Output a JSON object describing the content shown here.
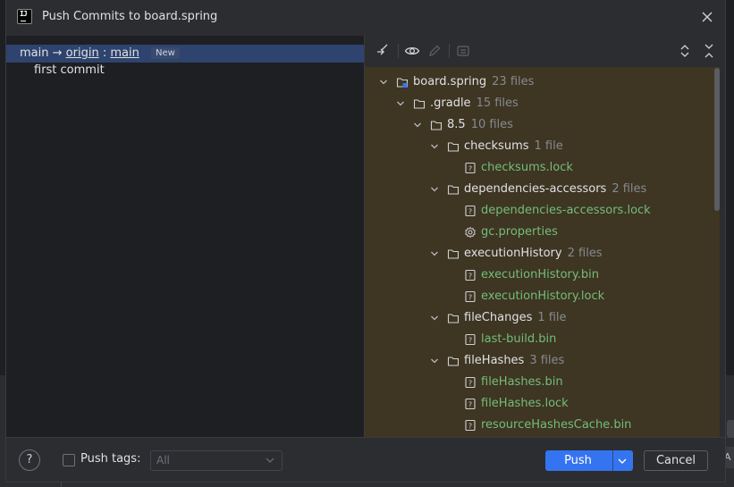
{
  "window": {
    "title": "Push Commits to board.spring",
    "app_icon_text": "IJ"
  },
  "commits": {
    "branch": {
      "local": "main",
      "arrow": "→",
      "remote": "origin",
      "colon": ":",
      "remote_branch": "main",
      "badge": "New"
    },
    "items": [
      {
        "message": "first commit"
      }
    ]
  },
  "toolbar": {
    "icons": [
      "collapse-icon",
      "eye-icon",
      "edit-icon",
      "group-icon",
      "expand-all-icon",
      "collapse-all-icon"
    ]
  },
  "tree": {
    "rows": [
      {
        "type": "module",
        "depth": 0,
        "name": "board.spring",
        "count": "23 files"
      },
      {
        "type": "folder",
        "depth": 1,
        "name": ".gradle",
        "count": "15 files"
      },
      {
        "type": "folder",
        "depth": 2,
        "name": "8.5",
        "count": "10 files"
      },
      {
        "type": "folder",
        "depth": 3,
        "name": "checksums",
        "count": "1 file"
      },
      {
        "type": "file",
        "depth": 4,
        "name": "checksums.lock",
        "icon": "unknown-file-icon"
      },
      {
        "type": "folder",
        "depth": 3,
        "name": "dependencies-accessors",
        "count": "2 files"
      },
      {
        "type": "file",
        "depth": 4,
        "name": "dependencies-accessors.lock",
        "icon": "unknown-file-icon"
      },
      {
        "type": "file",
        "depth": 4,
        "name": "gc.properties",
        "icon": "gear-icon"
      },
      {
        "type": "folder",
        "depth": 3,
        "name": "executionHistory",
        "count": "2 files"
      },
      {
        "type": "file",
        "depth": 4,
        "name": "executionHistory.bin",
        "icon": "unknown-file-icon"
      },
      {
        "type": "file",
        "depth": 4,
        "name": "executionHistory.lock",
        "icon": "unknown-file-icon"
      },
      {
        "type": "folder",
        "depth": 3,
        "name": "fileChanges",
        "count": "1 file"
      },
      {
        "type": "file",
        "depth": 4,
        "name": "last-build.bin",
        "icon": "unknown-file-icon"
      },
      {
        "type": "folder",
        "depth": 3,
        "name": "fileHashes",
        "count": "3 files"
      },
      {
        "type": "file",
        "depth": 4,
        "name": "fileHashes.bin",
        "icon": "unknown-file-icon"
      },
      {
        "type": "file",
        "depth": 4,
        "name": "fileHashes.lock",
        "icon": "unknown-file-icon"
      },
      {
        "type": "file",
        "depth": 4,
        "name": "resourceHashesCache.bin",
        "icon": "unknown-file-icon"
      }
    ]
  },
  "footer": {
    "help": "?",
    "push_tags_label": "Push tags:",
    "push_tags_checked": false,
    "tags_select_value": "All",
    "push_label": "Push",
    "cancel_label": "Cancel"
  },
  "background": {
    "edge_label": "A"
  },
  "colors": {
    "accent": "#3574f0",
    "selection": "#2e436e",
    "changed_file": "#73bd79",
    "tree_background": "#3e3522"
  }
}
